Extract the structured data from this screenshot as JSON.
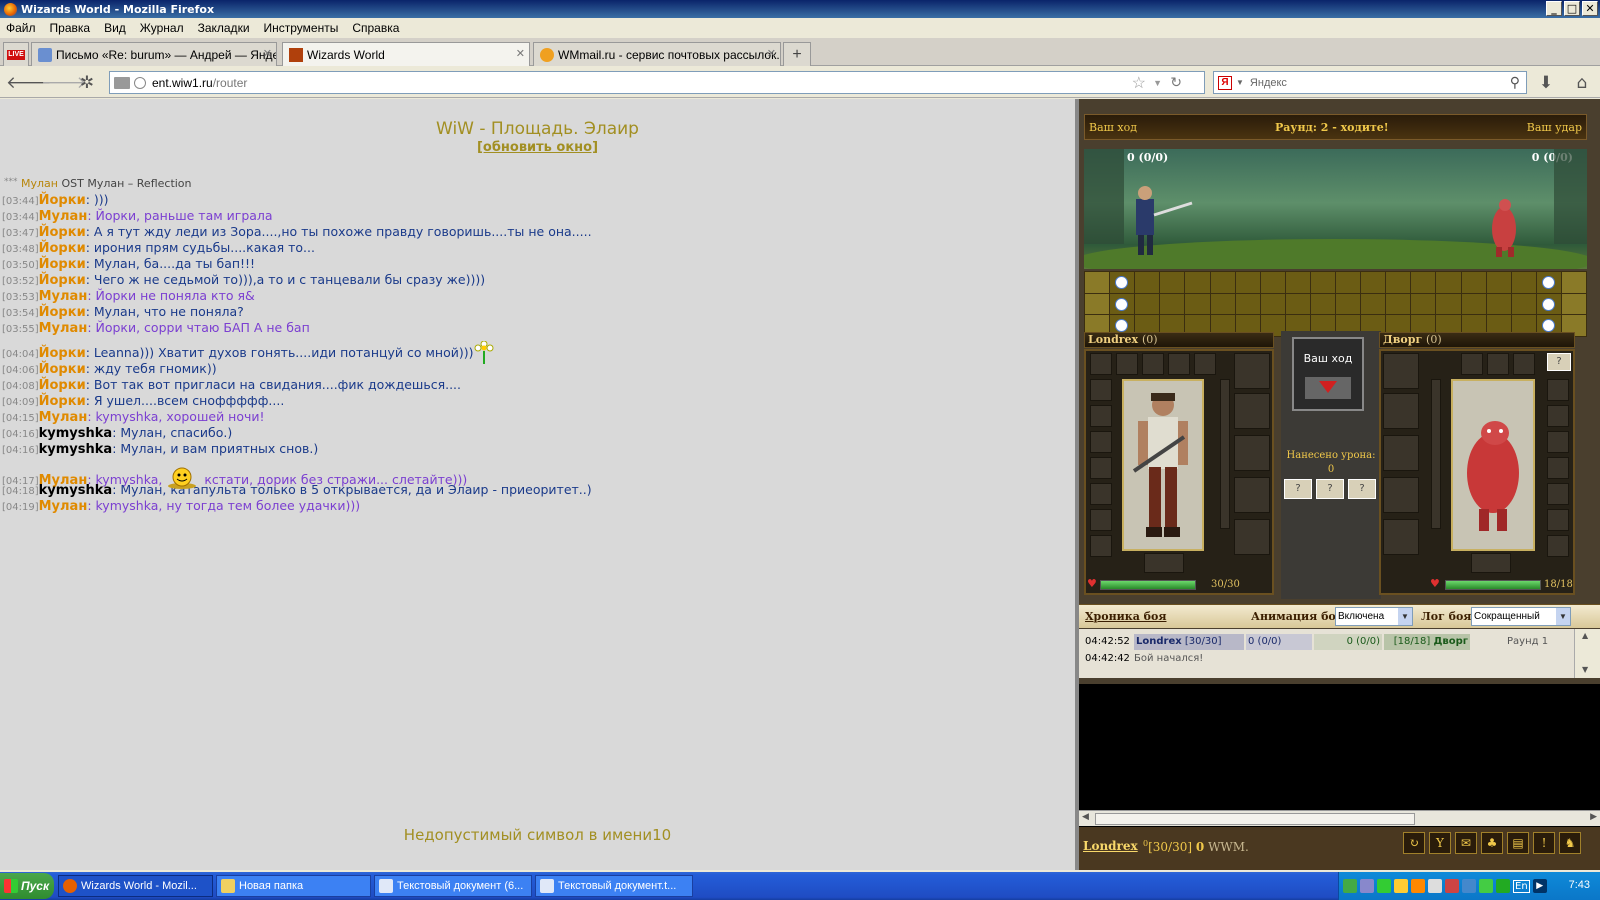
{
  "window": {
    "title": "Wizards World - Mozilla Firefox",
    "buttons": [
      "_",
      "□",
      "✕"
    ]
  },
  "menu": [
    "Файл",
    "Правка",
    "Вид",
    "Журнал",
    "Закладки",
    "Инструменты",
    "Справка"
  ],
  "tabs": [
    {
      "label": "LIVE",
      "active": false
    },
    {
      "label": "Письмо «Re: burum» — Андрей — Янде...",
      "active": false
    },
    {
      "label": "Wizards World",
      "active": true
    },
    {
      "label": "WMmail.ru - сервис почтовых рассылок...",
      "active": false
    }
  ],
  "newtab": "+",
  "url": {
    "host": "ent.wiw1.ru",
    "path": "/router"
  },
  "search": {
    "placeholder": "Яндекс",
    "ya": "Я"
  },
  "chat": {
    "title": "WiW - Площадь. Элаир",
    "refresh": "[обновить окно]",
    "ost_stars": "***",
    "ost_nick": "Мулан",
    "ost_text": " OST Мулан – Reflection",
    "lines": [
      {
        "time": "[03:44]",
        "nick": "Йорки",
        "nc": "n-y",
        "msg": "))) ",
        "mc": "msg-blue"
      },
      {
        "time": "[03:44]",
        "nick": "Мулан",
        "nc": "n-m",
        "msg": "Йорки, раньше там играла",
        "mc": "msg-violet"
      },
      {
        "time": "[03:47]",
        "nick": "Йорки",
        "nc": "n-y",
        "msg": "А я тут жду леди из Зора....,но ты похоже правду говоришь....ты не она.....",
        "mc": "msg-blue"
      },
      {
        "time": "[03:48]",
        "nick": "Йорки",
        "nc": "n-y",
        "msg": "ирония прям судьбы....какая то...",
        "mc": "msg-blue"
      },
      {
        "time": "[03:50]",
        "nick": "Йорки",
        "nc": "n-y",
        "msg": "Мулан, ба....да ты бап!!!",
        "mc": "msg-blue"
      },
      {
        "time": "[03:52]",
        "nick": "Йорки",
        "nc": "n-y",
        "msg": "Чего ж не седьмой то))),а то и с танцевали бы сразу же))))",
        "mc": "msg-blue"
      },
      {
        "time": "[03:53]",
        "nick": "Мулан",
        "nc": "n-m",
        "msg": "Йорки не поняла кто я&",
        "mc": "msg-violet"
      },
      {
        "time": "[03:54]",
        "nick": "Йорки",
        "nc": "n-y",
        "msg": "Мулан, что не поняла?",
        "mc": "msg-blue"
      },
      {
        "time": "[03:55]",
        "nick": "Мулан",
        "nc": "n-m",
        "msg": "Йорки, сорри чтаю БАП А не бап",
        "mc": "msg-violet"
      },
      {
        "time": "[04:04]",
        "nick": "Йорки",
        "nc": "n-y",
        "msg": "Leanna))) Хватит духов гонять....иди потанцуй со мной)))",
        "mc": "msg-blue",
        "gap": true,
        "flower": true
      },
      {
        "time": "[04:06]",
        "nick": "Йорки",
        "nc": "n-y",
        "msg": "жду тебя гномик))",
        "mc": "msg-blue"
      },
      {
        "time": "[04:08]",
        "nick": "Йорки",
        "nc": "n-y",
        "msg": "Вот так вот пригласи на свидания....фик дождешься....",
        "mc": "msg-blue"
      },
      {
        "time": "[04:09]",
        "nick": "Йорки",
        "nc": "n-y",
        "msg": "Я ушел....всем сноффффф....",
        "mc": "msg-blue"
      },
      {
        "time": "[04:15]",
        "nick": "Мулан",
        "nc": "n-m",
        "msg": "kymyshka, хорошей ночи!",
        "mc": "msg-violet"
      },
      {
        "time": "[04:16]",
        "nick": "kymyshka",
        "nc": "n-k",
        "msg": "Мулан, спасибо.)",
        "mc": "msg-blue"
      },
      {
        "time": "[04:16]",
        "nick": "kymyshka",
        "nc": "n-k",
        "msg": "Мулан, и вам приятных снов.)",
        "mc": "msg-blue"
      },
      {
        "time": "[04:17]",
        "nick": "Мулан",
        "nc": "n-m",
        "msg": "kymyshka,",
        "msg2": "кстати, дорик без стражи... слетайте)))",
        "mc": "msg-violet",
        "gap": true,
        "smile": true
      },
      {
        "time": "[04:18]",
        "nick": "kymyshka",
        "nc": "n-k",
        "msg": "Мулан, катапульта только в 5 открывается, да и Элаир - приеоритет..)",
        "mc": "msg-blue"
      },
      {
        "time": "[04:19]",
        "nick": "Мулан",
        "nc": "n-m",
        "msg": "kymyshka, ну тогда тем более удачки)))",
        "mc": "msg-violet"
      }
    ],
    "error": "Недопустимый символ в имени10"
  },
  "game": {
    "your_move": "Ваш ход",
    "round": "Раунд: 2 - ходите!",
    "your_hit": "Ваш удар",
    "hp_left": "0 (0/0)",
    "hp_right": "0 (0/0)",
    "player": {
      "name": "Londrex",
      "level": "(0)",
      "hp_text": "30/30",
      "hp_fraction": 1.0
    },
    "enemy": {
      "name": "Дворг",
      "level": "(0)",
      "hp_text": "18/18",
      "hp_fraction": 1.0
    },
    "move_box": "Ваш ход",
    "damage_label": "Нанесено урона:",
    "damage_value": "0",
    "q_buttons": [
      "?",
      "?",
      "?"
    ],
    "chronicle": "Хроника боя",
    "anim_label": "Анимация боя:",
    "anim_value": "Включена",
    "log_label": "Лог боя:",
    "log_value": "Сокращенный",
    "log": [
      {
        "time": "04:42:52",
        "p_name": "Londrex",
        "p_hp": "[30/30]",
        "a": "0 (0/0)",
        "b": "0 (0/0)",
        "e_hp": "[18/18]",
        "e_name": "Дворг",
        "round": "Раунд 1"
      },
      {
        "time": "04:42:42",
        "text": "Бой начался!"
      }
    ],
    "status": {
      "name": "Londrex",
      "sup": "0",
      "hp": "[30/30]",
      "money": "0",
      "currency": "WWM."
    }
  },
  "taskbar": {
    "start": "Пуск",
    "tasks": [
      "Wizards World - Mozil...",
      "Новая папка",
      "Текстовый документ (6...",
      "Текстовый документ.t..."
    ],
    "clock": "7:43",
    "lang": "En"
  },
  "colors": {
    "chat_gold": "#a28f22",
    "nick_orange": "#e08a00",
    "msg_blue": "#1a3a8a",
    "msg_violet": "#7b3fd1"
  }
}
